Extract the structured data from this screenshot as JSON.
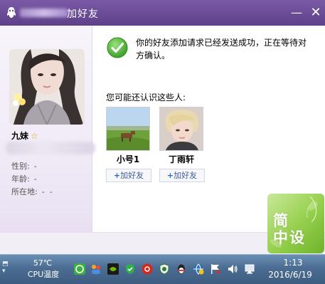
{
  "window": {
    "title": "加好友",
    "minimize_glyph": "—",
    "close_glyph": "✕"
  },
  "profile": {
    "name": "九妹",
    "fields": [
      {
        "label": "性别:",
        "value": "-"
      },
      {
        "label": "年龄:",
        "value": "-"
      },
      {
        "label": "所在地:",
        "value": "-  -"
      }
    ]
  },
  "message": {
    "text": "你的好友添加请求已经发送成功，正在等待对方确认。",
    "icon": "checkmark-circle-icon"
  },
  "suggestions": {
    "label": "您可能还认识这些人:",
    "add_label": "加好友",
    "people": [
      {
        "name": "小号1"
      },
      {
        "name": "丁雨轩"
      }
    ]
  },
  "watermark": {
    "line1": "简",
    "line2": "中设"
  },
  "taskbar": {
    "cpu_temp": "57℃",
    "cpu_label": "CPU温度",
    "time": "1:13",
    "date": "2016/6/19"
  },
  "colors": {
    "titlebar": "#5d3f8a",
    "success": "#45b035",
    "taskbar": "#4c6d93"
  }
}
